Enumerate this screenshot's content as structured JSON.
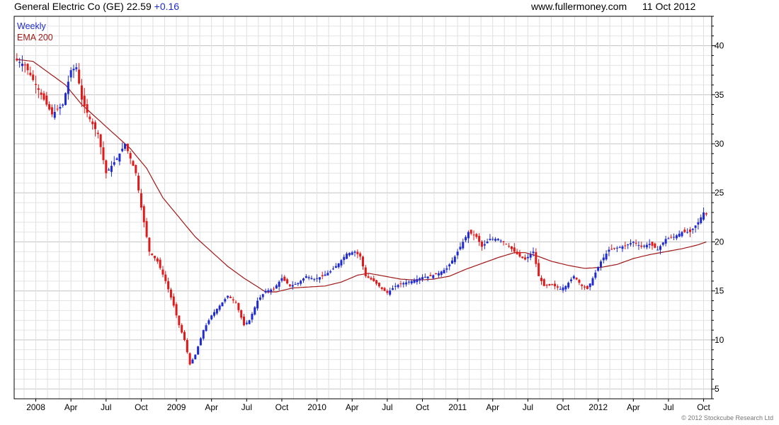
{
  "header": {
    "title": "General Electric Co (GE) 22.59",
    "change": "+0.16",
    "site": "www.fullermoney.com",
    "date": "11 Oct 2012"
  },
  "legend": {
    "weekly": "Weekly",
    "ema": "EMA 200"
  },
  "copyright": "© 2012 Stockcube Research Ltd",
  "colors": {
    "up": "#1f2bd1",
    "down": "#e01a1a",
    "ema": "#a01818",
    "grid": "#d6d6d6",
    "frame": "#000000"
  },
  "chart_data": {
    "type": "candlestick",
    "title": "General Electric Co (GE) 22.59 +0.16",
    "frequency": "Weekly",
    "ylim": [
      4,
      43
    ],
    "y_ticks": [
      5,
      10,
      15,
      20,
      25,
      30,
      35,
      40
    ],
    "x_ticks": [
      {
        "label": "2008",
        "week": 7
      },
      {
        "label": "Apr",
        "week": 20
      },
      {
        "label": "Jul",
        "week": 33
      },
      {
        "label": "Oct",
        "week": 46
      },
      {
        "label": "2009",
        "week": 59
      },
      {
        "label": "Apr",
        "week": 72
      },
      {
        "label": "Jul",
        "week": 85
      },
      {
        "label": "Oct",
        "week": 98
      },
      {
        "label": "2010",
        "week": 111
      },
      {
        "label": "Apr",
        "week": 124
      },
      {
        "label": "Jul",
        "week": 137
      },
      {
        "label": "Oct",
        "week": 150
      },
      {
        "label": "2011",
        "week": 163
      },
      {
        "label": "Apr",
        "week": 176
      },
      {
        "label": "Jul",
        "week": 189
      },
      {
        "label": "Oct",
        "week": 202
      },
      {
        "label": "2012",
        "week": 215
      },
      {
        "label": "Apr",
        "week": 228
      },
      {
        "label": "Jul",
        "week": 241
      },
      {
        "label": "Oct",
        "week": 254
      }
    ],
    "grid": true,
    "close_anchors": [
      [
        0,
        38.5
      ],
      [
        3,
        38.0
      ],
      [
        6,
        36.5
      ],
      [
        10,
        34.5
      ],
      [
        13,
        33.0
      ],
      [
        17,
        34.0
      ],
      [
        20,
        37.5
      ],
      [
        22,
        37.8
      ],
      [
        24,
        34.5
      ],
      [
        27,
        32.5
      ],
      [
        30,
        31.0
      ],
      [
        33,
        27.0
      ],
      [
        37,
        28.5
      ],
      [
        40,
        30.0
      ],
      [
        44,
        27.0
      ],
      [
        46,
        23.5
      ],
      [
        49,
        19.0
      ],
      [
        52,
        18.0
      ],
      [
        55,
        16.0
      ],
      [
        58,
        13.5
      ],
      [
        60,
        11.5
      ],
      [
        62,
        10.0
      ],
      [
        64,
        7.5
      ],
      [
        66,
        8.5
      ],
      [
        69,
        11.0
      ],
      [
        72,
        12.5
      ],
      [
        75,
        13.5
      ],
      [
        78,
        14.5
      ],
      [
        81,
        13.8
      ],
      [
        84,
        11.5
      ],
      [
        86,
        12.0
      ],
      [
        89,
        14.0
      ],
      [
        92,
        15.0
      ],
      [
        95,
        15.2
      ],
      [
        98,
        16.3
      ],
      [
        101,
        15.5
      ],
      [
        104,
        15.8
      ],
      [
        107,
        16.5
      ],
      [
        110,
        16.2
      ],
      [
        113,
        16.5
      ],
      [
        116,
        17.0
      ],
      [
        119,
        17.8
      ],
      [
        122,
        18.8
      ],
      [
        125,
        19.0
      ],
      [
        127,
        18.5
      ],
      [
        129,
        16.5
      ],
      [
        132,
        16.0
      ],
      [
        135,
        15.2
      ],
      [
        137,
        14.8
      ],
      [
        140,
        15.5
      ],
      [
        143,
        15.8
      ],
      [
        146,
        16.0
      ],
      [
        150,
        16.4
      ],
      [
        153,
        16.5
      ],
      [
        156,
        16.8
      ],
      [
        159,
        17.3
      ],
      [
        162,
        18.5
      ],
      [
        165,
        20.0
      ],
      [
        167,
        21.0
      ],
      [
        170,
        20.5
      ],
      [
        172,
        19.5
      ],
      [
        175,
        20.3
      ],
      [
        178,
        20.3
      ],
      [
        181,
        19.8
      ],
      [
        184,
        19.0
      ],
      [
        186,
        18.5
      ],
      [
        188,
        18.2
      ],
      [
        191,
        19.0
      ],
      [
        193,
        16.5
      ],
      [
        195,
        15.5
      ],
      [
        198,
        15.6
      ],
      [
        201,
        15.2
      ],
      [
        203,
        15.5
      ],
      [
        206,
        16.5
      ],
      [
        209,
        15.5
      ],
      [
        211,
        15.2
      ],
      [
        213,
        16.3
      ],
      [
        216,
        18.0
      ],
      [
        219,
        19.2
      ],
      [
        222,
        19.4
      ],
      [
        225,
        19.6
      ],
      [
        228,
        20.0
      ],
      [
        231,
        19.5
      ],
      [
        234,
        19.8
      ],
      [
        237,
        19.2
      ],
      [
        240,
        20.3
      ],
      [
        243,
        20.5
      ],
      [
        246,
        21.0
      ],
      [
        249,
        21.0
      ],
      [
        252,
        22.0
      ],
      [
        254,
        23.0
      ],
      [
        255,
        22.8
      ]
    ],
    "ema200_anchors": [
      [
        0,
        38.6
      ],
      [
        6,
        38.4
      ],
      [
        12,
        37.2
      ],
      [
        18,
        36.0
      ],
      [
        24,
        34.0
      ],
      [
        30,
        32.5
      ],
      [
        36,
        31.0
      ],
      [
        42,
        29.5
      ],
      [
        48,
        27.5
      ],
      [
        54,
        24.5
      ],
      [
        60,
        22.5
      ],
      [
        66,
        20.5
      ],
      [
        72,
        19.0
      ],
      [
        78,
        17.5
      ],
      [
        84,
        16.3
      ],
      [
        88,
        15.6
      ],
      [
        92,
        14.9
      ],
      [
        96,
        14.9
      ],
      [
        102,
        15.3
      ],
      [
        108,
        15.4
      ],
      [
        114,
        15.5
      ],
      [
        120,
        15.9
      ],
      [
        126,
        16.6
      ],
      [
        130,
        16.8
      ],
      [
        136,
        16.5
      ],
      [
        142,
        16.2
      ],
      [
        148,
        16.1
      ],
      [
        154,
        16.2
      ],
      [
        160,
        16.5
      ],
      [
        166,
        17.2
      ],
      [
        172,
        17.8
      ],
      [
        178,
        18.4
      ],
      [
        184,
        18.9
      ],
      [
        188,
        18.9
      ],
      [
        192,
        18.6
      ],
      [
        198,
        18.0
      ],
      [
        204,
        17.6
      ],
      [
        210,
        17.3
      ],
      [
        216,
        17.4
      ],
      [
        222,
        17.7
      ],
      [
        228,
        18.3
      ],
      [
        234,
        18.7
      ],
      [
        240,
        19.0
      ],
      [
        246,
        19.3
      ],
      [
        252,
        19.7
      ],
      [
        255,
        20.0
      ]
    ]
  }
}
